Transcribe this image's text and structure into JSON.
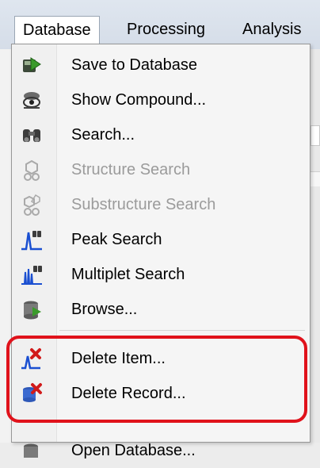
{
  "menubar": {
    "items": [
      {
        "label": "Database",
        "active": true
      },
      {
        "label": "Processing"
      },
      {
        "label": "Analysis"
      }
    ]
  },
  "dropdown": {
    "items": [
      {
        "label": "Save to Database",
        "icon": "save-to-database-icon",
        "enabled": true
      },
      {
        "label": "Show Compound...",
        "icon": "show-compound-icon",
        "enabled": true
      },
      {
        "label": "Search...",
        "icon": "binoculars-search-icon",
        "enabled": true
      },
      {
        "label": "Structure Search",
        "icon": "structure-search-icon",
        "enabled": false
      },
      {
        "label": "Substructure Search",
        "icon": "substructure-search-icon",
        "enabled": false
      },
      {
        "label": "Peak Search",
        "icon": "peak-search-icon",
        "enabled": true
      },
      {
        "label": "Multiplet Search",
        "icon": "multiplet-search-icon",
        "enabled": true
      },
      {
        "label": "Browse...",
        "icon": "browse-database-icon",
        "enabled": true
      },
      {
        "label": "Delete Item...",
        "icon": "delete-item-icon",
        "enabled": true
      },
      {
        "label": "Delete Record...",
        "icon": "delete-record-icon",
        "enabled": true
      },
      {
        "label": "Open Database...",
        "icon": "open-database-icon",
        "enabled": true
      }
    ]
  },
  "colors": {
    "highlight": "#e0121b",
    "disabled_text": "#9b9b9b"
  }
}
